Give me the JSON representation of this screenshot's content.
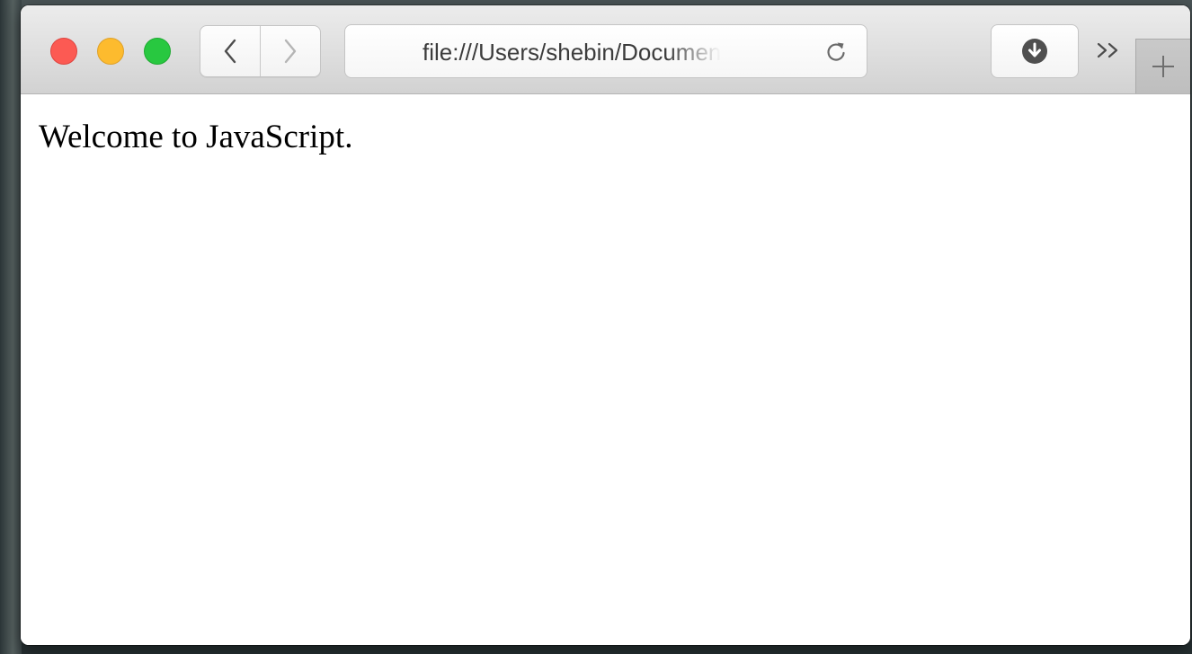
{
  "browser": {
    "address_bar": {
      "url": "file:///Users/shebin/Documents/"
    },
    "toolbar": {
      "traffic_lights": {
        "close_color": "#fc5a53",
        "minimize_color": "#fdbb2e",
        "zoom_color": "#28c840"
      },
      "icons": [
        "chevron-left-icon",
        "chevron-right-icon",
        "reload-icon",
        "download-icon",
        "double-chevron-right-icon",
        "plus-icon"
      ]
    }
  },
  "page": {
    "body_text": "Welcome to JavaScript."
  }
}
